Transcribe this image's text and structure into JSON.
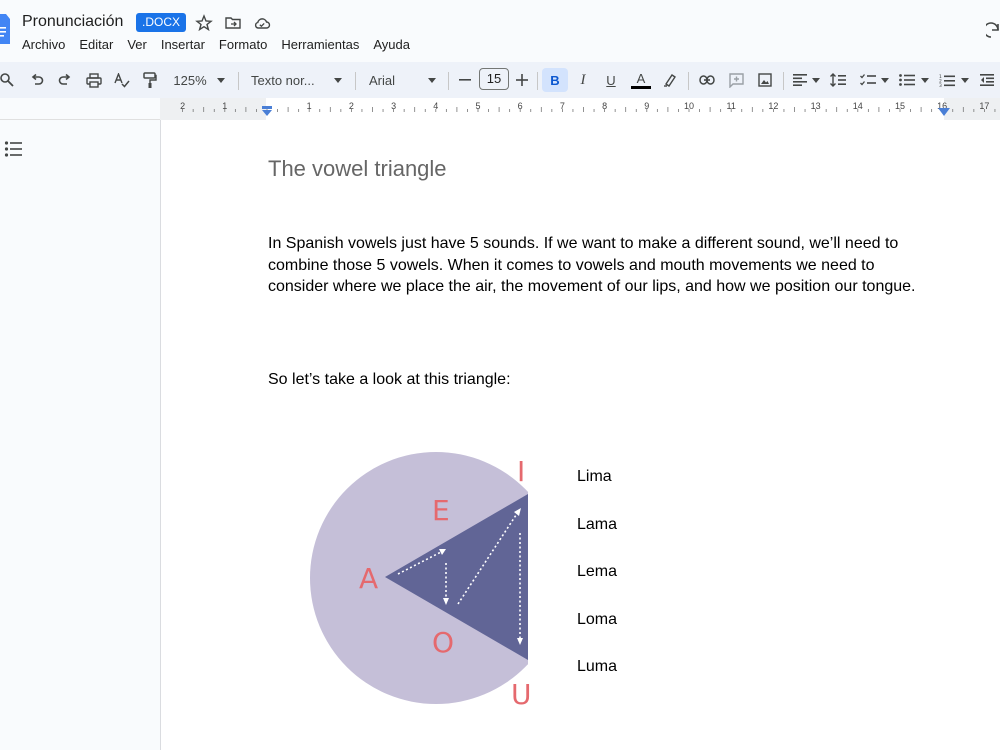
{
  "titlebar": {
    "title": "Pronunciación",
    "badge": ".DOCX",
    "menu": [
      "Archivo",
      "Editar",
      "Ver",
      "Insertar",
      "Formato",
      "Herramientas",
      "Ayuda"
    ]
  },
  "toolbar": {
    "zoom": "125%",
    "style": "Texto nor...",
    "font": "Arial",
    "font_size": "15",
    "bold": "B",
    "italic": "I",
    "underline": "U",
    "text_color": "A"
  },
  "ruler": {
    "labels": [
      "2",
      "1",
      "1",
      "2",
      "3",
      "4",
      "5",
      "6",
      "7",
      "8",
      "9",
      "10",
      "11",
      "12",
      "13",
      "14",
      "15",
      "16",
      "17"
    ]
  },
  "document": {
    "title": "The vowel triangle",
    "paragraph1": "In Spanish vowels just have 5 sounds. If we want to make a different sound, we’ll need to combine those 5 vowels. When it comes to vowels and mouth movements we need to consider where we place the air, the movement of our lips, and how we position our tongue.",
    "paragraph2": "So let’s take a look at this triangle:",
    "vowels": {
      "i": "I",
      "e": "E",
      "a": "A",
      "o": "O",
      "u": "U"
    },
    "words": [
      "Lima",
      "Lama",
      "Lema",
      "Loma",
      "Luma"
    ]
  },
  "colors": {
    "accent": "#1a73e8",
    "vowel_red": "#e5696e",
    "circle": "#c5bfd8",
    "triangle": "#616596"
  }
}
